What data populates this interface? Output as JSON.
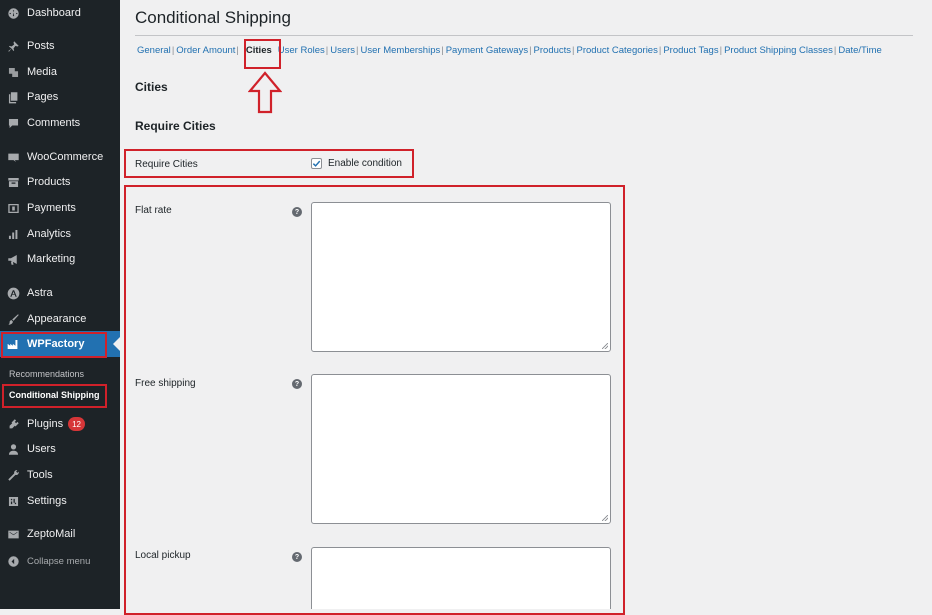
{
  "sidebar": {
    "items": [
      {
        "label": "Dashboard",
        "icon": "dashboard-icon"
      },
      {
        "label": "Posts",
        "icon": "pin-icon"
      },
      {
        "label": "Media",
        "icon": "media-icon"
      },
      {
        "label": "Pages",
        "icon": "pages-icon"
      },
      {
        "label": "Comments",
        "icon": "comment-icon"
      },
      {
        "label": "WooCommerce",
        "icon": "woocommerce-icon"
      },
      {
        "label": "Products",
        "icon": "archive-icon"
      },
      {
        "label": "Payments",
        "icon": "payments-icon"
      },
      {
        "label": "Analytics",
        "icon": "bar-chart-icon"
      },
      {
        "label": "Marketing",
        "icon": "megaphone-icon"
      },
      {
        "label": "Astra",
        "icon": "astra-icon"
      },
      {
        "label": "Appearance",
        "icon": "brush-icon"
      },
      {
        "label": "WPFactory",
        "icon": "factory-icon"
      },
      {
        "label": "Plugins",
        "icon": "plugin-icon",
        "badge": "12"
      },
      {
        "label": "Users",
        "icon": "user-icon"
      },
      {
        "label": "Tools",
        "icon": "wrench-icon"
      },
      {
        "label": "Settings",
        "icon": "settings-icon"
      },
      {
        "label": "ZeptoMail",
        "icon": "mail-icon"
      }
    ],
    "submenu": [
      "Recommendations",
      "Conditional Shipping"
    ],
    "collapse_label": "Collapse menu"
  },
  "page": {
    "title": "Conditional Shipping",
    "tabs": [
      "General",
      "Order Amount",
      "Cities",
      "User Roles",
      "Users",
      "User Memberships",
      "Payment Gateways",
      "Products",
      "Product Categories",
      "Product Tags",
      "Product Shipping Classes",
      "Date/Time"
    ],
    "section_title": "Cities",
    "subsection_title": "Require Cities",
    "require_label": "Require Cities",
    "enable_label": "Enable condition",
    "help_glyph": "?",
    "fields": [
      {
        "label": "Flat rate",
        "value": ""
      },
      {
        "label": "Free shipping",
        "value": ""
      },
      {
        "label": "Local pickup",
        "value": ""
      }
    ]
  },
  "colors": {
    "sidebar_bg": "#1d2327",
    "accent": "#2271b1",
    "highlight": "#d0212a",
    "badge": "#d63638"
  }
}
